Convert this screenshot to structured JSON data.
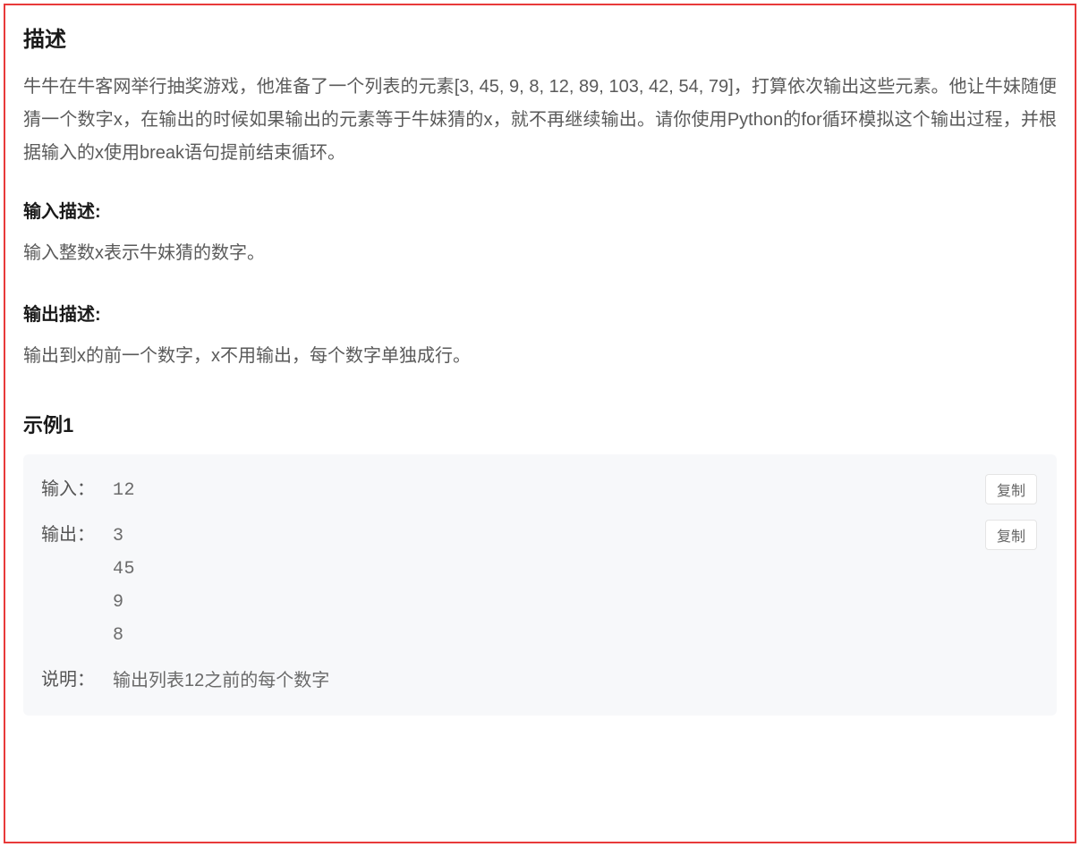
{
  "description": {
    "title": "描述",
    "body": "牛牛在牛客网举行抽奖游戏，他准备了一个列表的元素[3, 45, 9, 8, 12, 89, 103, 42, 54, 79]，打算依次输出这些元素。他让牛妹随便猜一个数字x，在输出的时候如果输出的元素等于牛妹猜的x，就不再继续输出。请你使用Python的for循环模拟这个输出过程，并根据输入的x使用break语句提前结束循环。"
  },
  "input_desc": {
    "title": "输入描述:",
    "body": "输入整数x表示牛妹猜的数字。"
  },
  "output_desc": {
    "title": "输出描述:",
    "body": "输出到x的前一个数字，x不用输出，每个数字单独成行。"
  },
  "example": {
    "title": "示例1",
    "input_label": "输入：",
    "output_label": "输出：",
    "explain_label": "说明：",
    "copy_label": "复制",
    "input_value": "12",
    "output_value": "3\n45\n9\n8",
    "explain_value": "输出列表12之前的每个数字"
  }
}
